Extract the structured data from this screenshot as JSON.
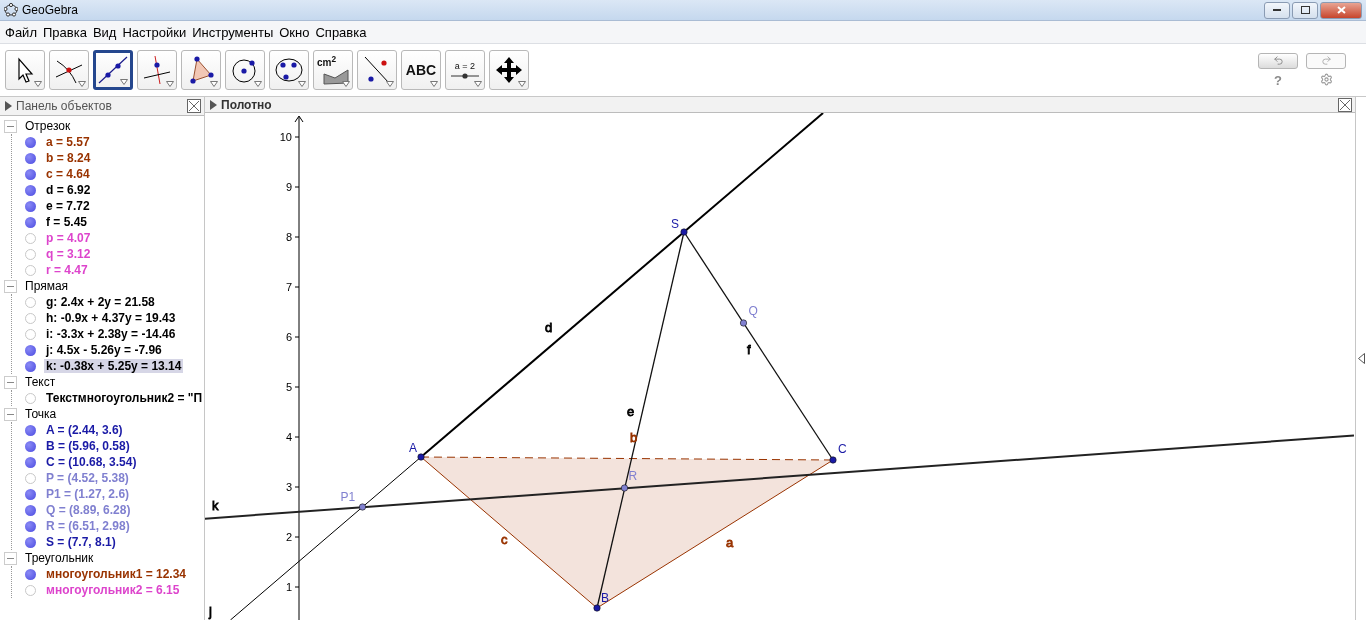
{
  "window": {
    "title": "GeoGebra"
  },
  "menu": [
    "Файл",
    "Правка",
    "Вид",
    "Настройки",
    "Инструменты",
    "Окно",
    "Справка"
  ],
  "toolbar": {
    "tools": [
      {
        "kind": "move",
        "selected": false
      },
      {
        "kind": "intersect",
        "selected": false
      },
      {
        "kind": "line",
        "selected": true
      },
      {
        "kind": "perpendicular",
        "selected": false
      },
      {
        "kind": "polygon",
        "selected": false
      },
      {
        "kind": "circle",
        "selected": false
      },
      {
        "kind": "circle3",
        "selected": false
      },
      {
        "kind": "area",
        "selected": false,
        "label": "cm$^{2}$"
      },
      {
        "kind": "reflect",
        "selected": false
      },
      {
        "kind": "text",
        "selected": false,
        "label": "ABC"
      },
      {
        "kind": "slider",
        "selected": false,
        "label": "a = 2"
      },
      {
        "kind": "pan",
        "selected": false
      }
    ],
    "help": "?"
  },
  "algebra": {
    "title": "Панель объектов",
    "groups": [
      {
        "name": "Отрезок",
        "expanded": true,
        "items": [
          {
            "text": "a = 5.57",
            "visible": true,
            "color": "#993300",
            "selected": false
          },
          {
            "text": "b = 8.24",
            "visible": true,
            "color": "#993300",
            "selected": false
          },
          {
            "text": "c = 4.64",
            "visible": true,
            "color": "#993300",
            "selected": false
          },
          {
            "text": "d = 6.92",
            "visible": true,
            "color": "#000000",
            "selected": false
          },
          {
            "text": "e = 7.72",
            "visible": true,
            "color": "#000000",
            "selected": false
          },
          {
            "text": "f = 5.45",
            "visible": true,
            "color": "#000000",
            "selected": false
          },
          {
            "text": "p = 4.07",
            "visible": false,
            "color": "#dd44cc",
            "selected": false
          },
          {
            "text": "q = 3.12",
            "visible": false,
            "color": "#dd44cc",
            "selected": false
          },
          {
            "text": "r = 4.47",
            "visible": false,
            "color": "#dd44cc",
            "selected": false
          }
        ]
      },
      {
        "name": "Прямая",
        "expanded": true,
        "items": [
          {
            "text": "g: 2.4x + 2y = 21.58",
            "visible": false,
            "color": "#000000",
            "selected": false
          },
          {
            "text": "h: -0.9x + 4.37y = 19.43",
            "visible": false,
            "color": "#000000",
            "selected": false
          },
          {
            "text": "i: -3.3x + 2.38y = -14.46",
            "visible": false,
            "color": "#000000",
            "selected": false
          },
          {
            "text": "j: 4.5x - 5.26y = -7.96",
            "visible": true,
            "color": "#000000",
            "selected": false
          },
          {
            "text": "k: -0.38x + 5.25y = 13.14",
            "visible": true,
            "color": "#000000",
            "selected": true
          }
        ]
      },
      {
        "name": "Текст",
        "expanded": true,
        "items": [
          {
            "text": "Текстмногоугольник2 = \"П",
            "visible": false,
            "color": "#000000",
            "selected": false
          }
        ]
      },
      {
        "name": "Точка",
        "expanded": true,
        "items": [
          {
            "text": "A = (2.44, 3.6)",
            "visible": true,
            "color": "#1a1aa6",
            "selected": false
          },
          {
            "text": "B = (5.96, 0.58)",
            "visible": true,
            "color": "#1a1aa6",
            "selected": false
          },
          {
            "text": "C = (10.68, 3.54)",
            "visible": true,
            "color": "#1a1aa6",
            "selected": false
          },
          {
            "text": "P = (4.52, 5.38)",
            "visible": false,
            "color": "#8080d0",
            "selected": false
          },
          {
            "text": "P1 = (1.27, 2.6)",
            "visible": true,
            "color": "#8080d0",
            "selected": false
          },
          {
            "text": "Q = (8.89, 6.28)",
            "visible": true,
            "color": "#8080d0",
            "selected": false
          },
          {
            "text": "R = (6.51, 2.98)",
            "visible": true,
            "color": "#8080d0",
            "selected": false
          },
          {
            "text": "S = (7.7, 8.1)",
            "visible": true,
            "color": "#1a1aa6",
            "selected": false
          }
        ]
      },
      {
        "name": "Треугольник",
        "expanded": true,
        "items": [
          {
            "text": "многоугольник1 = 12.34",
            "visible": true,
            "color": "#993300",
            "selected": false
          },
          {
            "text": "многоугольник2 = 6.15",
            "visible": false,
            "color": "#dd44cc",
            "selected": false
          }
        ]
      }
    ]
  },
  "canvas": {
    "title": "Полотно",
    "y_ticks": [
      "10",
      "9",
      "8",
      "7",
      "6",
      "5",
      "4",
      "3",
      "2",
      "1"
    ],
    "points": [
      {
        "label": "A",
        "color": "#1a1aa6"
      },
      {
        "label": "B",
        "color": "#1a1aa6"
      },
      {
        "label": "C",
        "color": "#1a1aa6"
      },
      {
        "label": "S",
        "color": "#1a1aa6"
      },
      {
        "label": "Q",
        "color": "#8080d0"
      },
      {
        "label": "R",
        "color": "#8080d0"
      },
      {
        "label": "P1",
        "color": "#8080d0"
      }
    ],
    "object_labels": [
      {
        "text": "d",
        "color": "#000000"
      },
      {
        "text": "e",
        "color": "#000000"
      },
      {
        "text": "b",
        "color": "#993300"
      },
      {
        "text": "f",
        "color": "#000000"
      },
      {
        "text": "c",
        "color": "#993300"
      },
      {
        "text": "a",
        "color": "#993300"
      },
      {
        "text": "k",
        "color": "#000000"
      },
      {
        "text": "j",
        "color": "#000000"
      }
    ]
  }
}
